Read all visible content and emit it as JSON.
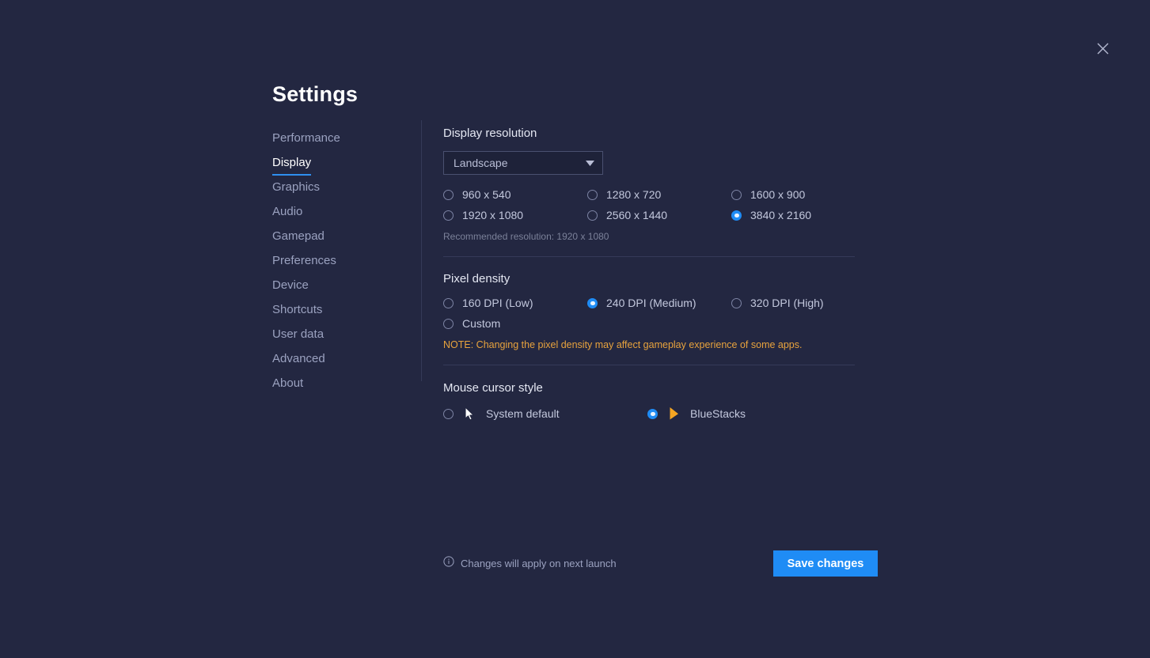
{
  "window": {
    "title": "Settings",
    "close_icon": "close-icon"
  },
  "sidebar": {
    "items": [
      {
        "label": "Performance",
        "active": false
      },
      {
        "label": "Display",
        "active": true
      },
      {
        "label": "Graphics",
        "active": false
      },
      {
        "label": "Audio",
        "active": false
      },
      {
        "label": "Gamepad",
        "active": false
      },
      {
        "label": "Preferences",
        "active": false
      },
      {
        "label": "Device",
        "active": false
      },
      {
        "label": "Shortcuts",
        "active": false
      },
      {
        "label": "User data",
        "active": false
      },
      {
        "label": "Advanced",
        "active": false
      },
      {
        "label": "About",
        "active": false
      }
    ]
  },
  "display_resolution": {
    "title": "Display resolution",
    "orientation": {
      "value": "Landscape",
      "icon": "chevron-down-icon"
    },
    "options": [
      {
        "label": "960 x 540",
        "selected": false
      },
      {
        "label": "1280 x 720",
        "selected": false
      },
      {
        "label": "1600 x 900",
        "selected": false
      },
      {
        "label": "1920 x 1080",
        "selected": false
      },
      {
        "label": "2560 x 1440",
        "selected": false
      },
      {
        "label": "3840 x 2160",
        "selected": true
      }
    ],
    "recommendation": "Recommended resolution: 1920 x 1080"
  },
  "pixel_density": {
    "title": "Pixel density",
    "options": [
      {
        "label": "160 DPI (Low)",
        "selected": false
      },
      {
        "label": "240 DPI (Medium)",
        "selected": true
      },
      {
        "label": "320 DPI (High)",
        "selected": false
      },
      {
        "label": "Custom",
        "selected": false
      }
    ],
    "note": "NOTE: Changing the pixel density may affect gameplay experience of some apps."
  },
  "mouse_cursor_style": {
    "title": "Mouse cursor style",
    "options": [
      {
        "label": "System default",
        "selected": false,
        "icon": "cursor-arrow-white-icon"
      },
      {
        "label": "BlueStacks",
        "selected": true,
        "icon": "cursor-arrow-orange-icon"
      }
    ]
  },
  "footer": {
    "info_icon": "info-circle-icon",
    "note": "Changes will apply on next launch",
    "save_label": "Save changes"
  },
  "colors": {
    "background": "#232741",
    "accent_blue": "#1f8cf5",
    "note_orange": "#e8a33d",
    "cursor_orange": "#f5a623",
    "text_primary": "#ffffff",
    "text_secondary": "#c3c8dd",
    "text_muted": "#9ba2c0",
    "divider": "#353a58"
  }
}
